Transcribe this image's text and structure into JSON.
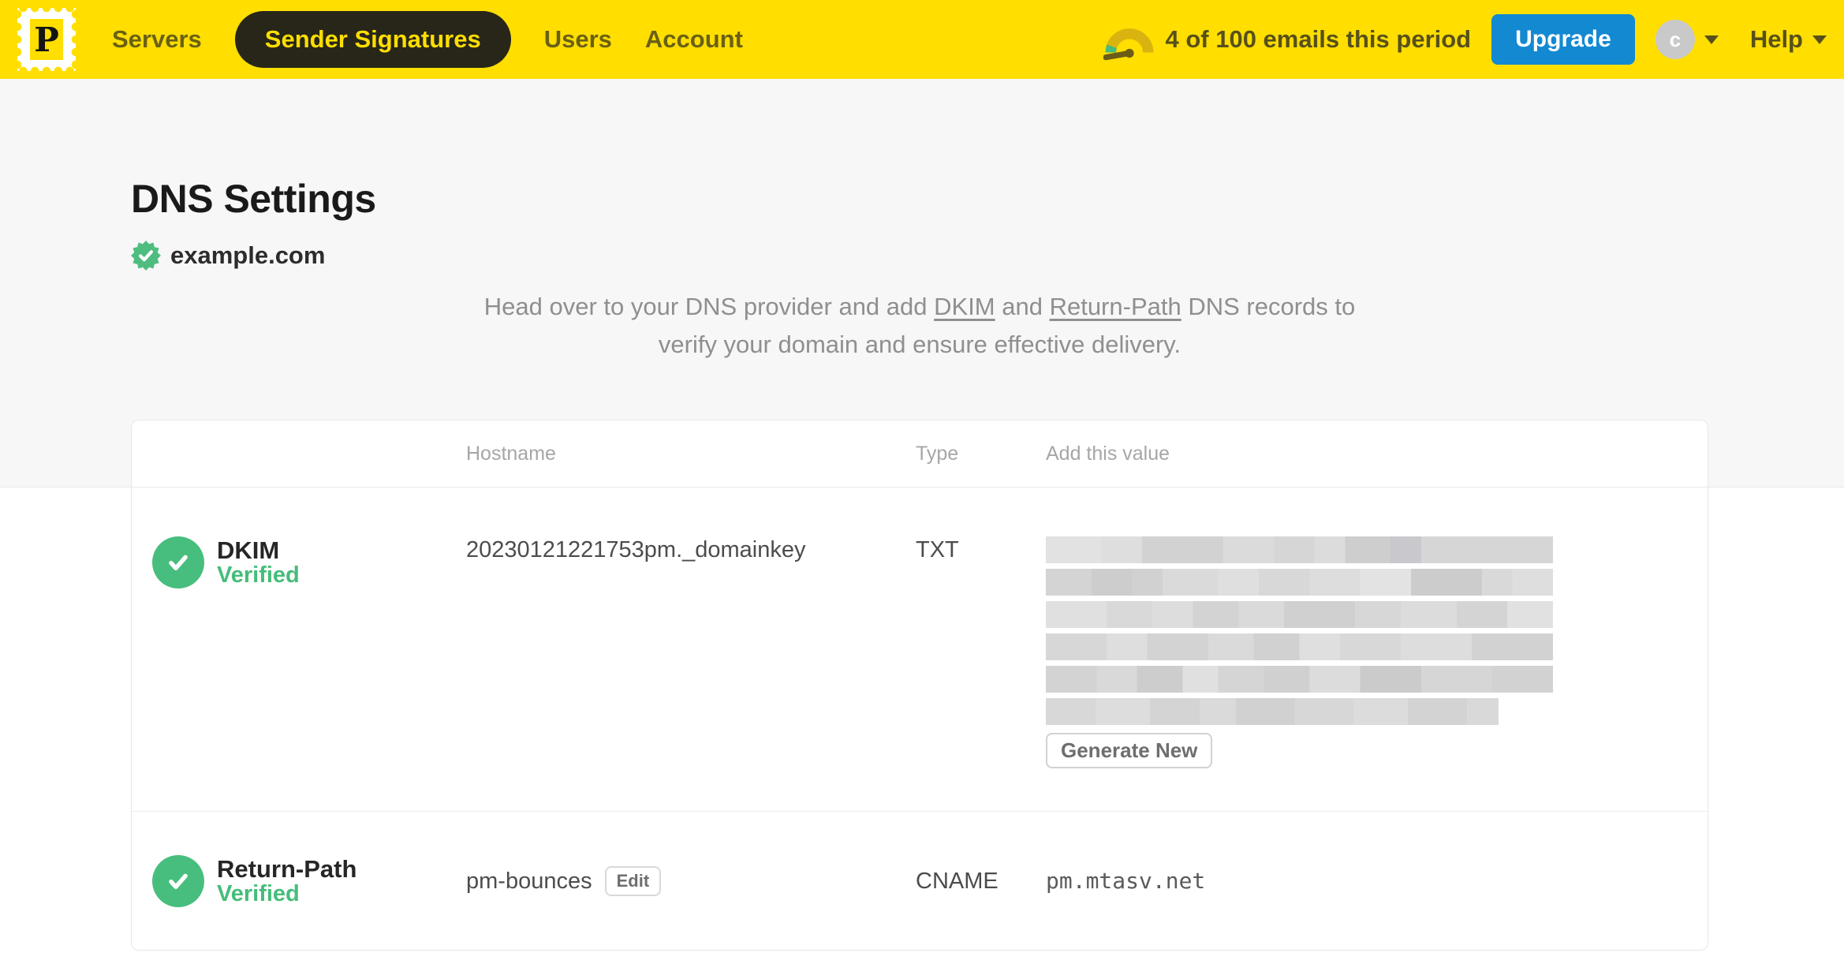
{
  "navbar": {
    "logo_letter": "P",
    "items": [
      {
        "label": "Servers",
        "active": false
      },
      {
        "label": "Sender Signatures",
        "active": true
      },
      {
        "label": "Users",
        "active": false
      },
      {
        "label": "Account",
        "active": false
      }
    ],
    "usage_text": "4 of 100 emails this period",
    "upgrade_label": "Upgrade",
    "avatar_initial": "c",
    "help_label": "Help"
  },
  "hero": {
    "title": "DNS Settings",
    "domain": "example.com",
    "instructions": {
      "part1": "Head over to your DNS provider and add ",
      "dkim_link": "DKIM",
      "part2": " and ",
      "return_path_link": "Return-Path",
      "part3a": " DNS records to",
      "part3b": "verify your domain and ensure effective delivery."
    }
  },
  "table": {
    "headers": {
      "hostname": "Hostname",
      "type": "Type",
      "value": "Add this value"
    },
    "rows": [
      {
        "name": "DKIM",
        "status": "Verified",
        "hostname": "20230121221753pm._domainkey",
        "type": "TXT",
        "value_redacted": true,
        "action_label": "Generate New"
      },
      {
        "name": "Return-Path",
        "status": "Verified",
        "hostname": "pm-bounces",
        "hostname_action_label": "Edit",
        "type": "CNAME",
        "value": "pm.mtasv.net"
      }
    ]
  },
  "colors": {
    "brand_yellow": "#FFDE00",
    "upgrade_blue": "#1389D2",
    "success_green": "#47BE7D",
    "nav_text": "#6a6014"
  }
}
